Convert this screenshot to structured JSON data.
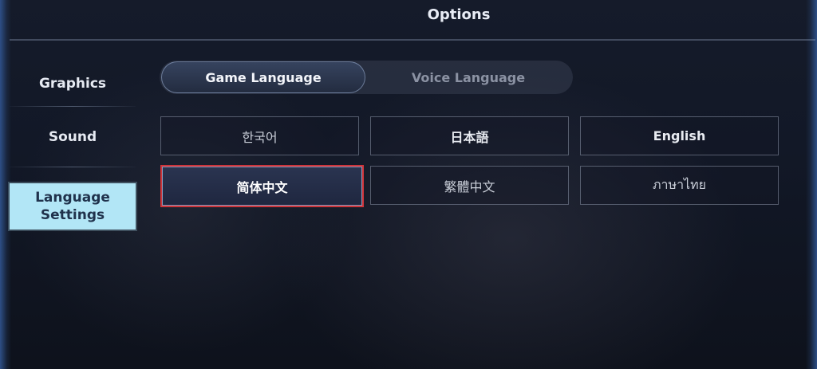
{
  "header": {
    "title": "Options"
  },
  "sidebar": {
    "items": [
      {
        "label": "Graphics"
      },
      {
        "label": "Sound"
      },
      {
        "label": "Language Settings"
      }
    ]
  },
  "tabs": [
    {
      "label": "Game Language"
    },
    {
      "label": "Voice Language"
    }
  ],
  "languages": [
    {
      "label": "한국어"
    },
    {
      "label": "日本語"
    },
    {
      "label": "English"
    },
    {
      "label": "简体中文"
    },
    {
      "label": "繁體中文"
    },
    {
      "label": "ภาษาไทย"
    }
  ],
  "colors": {
    "accent": "#b2e6f6",
    "selection_outline": "#d0343a",
    "frame_edge": "#2d4f86"
  }
}
